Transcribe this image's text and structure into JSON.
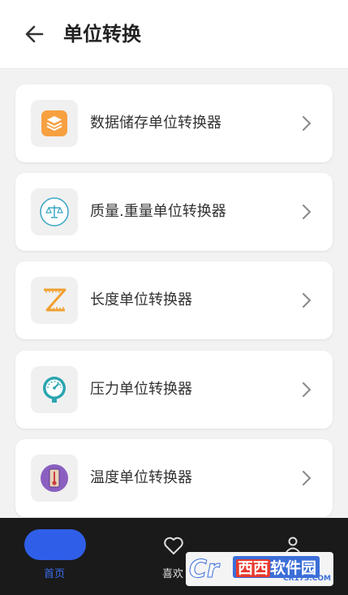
{
  "header": {
    "title": "单位转换",
    "back_icon": "arrow-left-icon"
  },
  "converters": [
    {
      "label": "数据储存单位转换器",
      "icon": "layers-icon",
      "color": "#f7a040"
    },
    {
      "label": "质量.重量单位转换器",
      "icon": "scale-icon",
      "color": "#3aa7c4"
    },
    {
      "label": "长度单位转换器",
      "icon": "ruler-icon",
      "color": "#f0a030"
    },
    {
      "label": "压力单位转换器",
      "icon": "pressure-gauge-icon",
      "color": "#2aa5b0"
    },
    {
      "label": "温度单位转换器",
      "icon": "thermometer-icon",
      "color": "#8a5fc0"
    }
  ],
  "bottom_nav": {
    "home_label": "首页",
    "favorites_label": "喜欢",
    "profile_icon": "user-icon",
    "active_color": "#2f5fe8"
  },
  "watermark": {
    "logo": "Cr",
    "brand_part1": "西西",
    "brand_part2": "软件园",
    "url": "CR173.COM"
  }
}
